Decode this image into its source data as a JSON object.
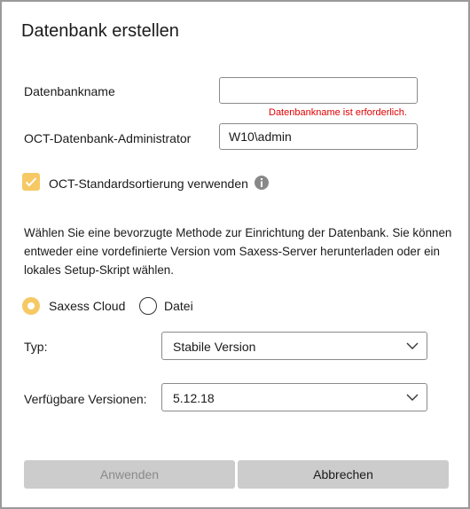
{
  "dialog": {
    "title": "Datenbank erstellen"
  },
  "form": {
    "dbname": {
      "label": "Datenbankname",
      "value": "",
      "error": "Datenbankname ist erforderlich."
    },
    "admin": {
      "label": "OCT-Datenbank-Administrator",
      "value": "W10\\admin"
    },
    "sort_checkbox": {
      "label": "OCT-Standardsortierung verwenden",
      "checked": true
    },
    "paragraph": "Wählen Sie eine bevorzugte Methode zur Einrichtung der Datenbank. Sie können entweder eine vordefinierte Version vom Saxess-Server herunterladen oder ein lokales Setup-Skript wählen.",
    "source": {
      "options": [
        {
          "label": "Saxess Cloud",
          "selected": true
        },
        {
          "label": "Datei",
          "selected": false
        }
      ]
    },
    "type": {
      "label": "Typ:",
      "value": "Stabile Version"
    },
    "versions": {
      "label": "Verfügbare Versionen:",
      "value": "5.12.18"
    }
  },
  "buttons": {
    "apply": "Anwenden",
    "cancel": "Abbrechen"
  },
  "colors": {
    "accent": "#f6c965",
    "error": "#e00000",
    "button_bg": "#cccccc"
  }
}
